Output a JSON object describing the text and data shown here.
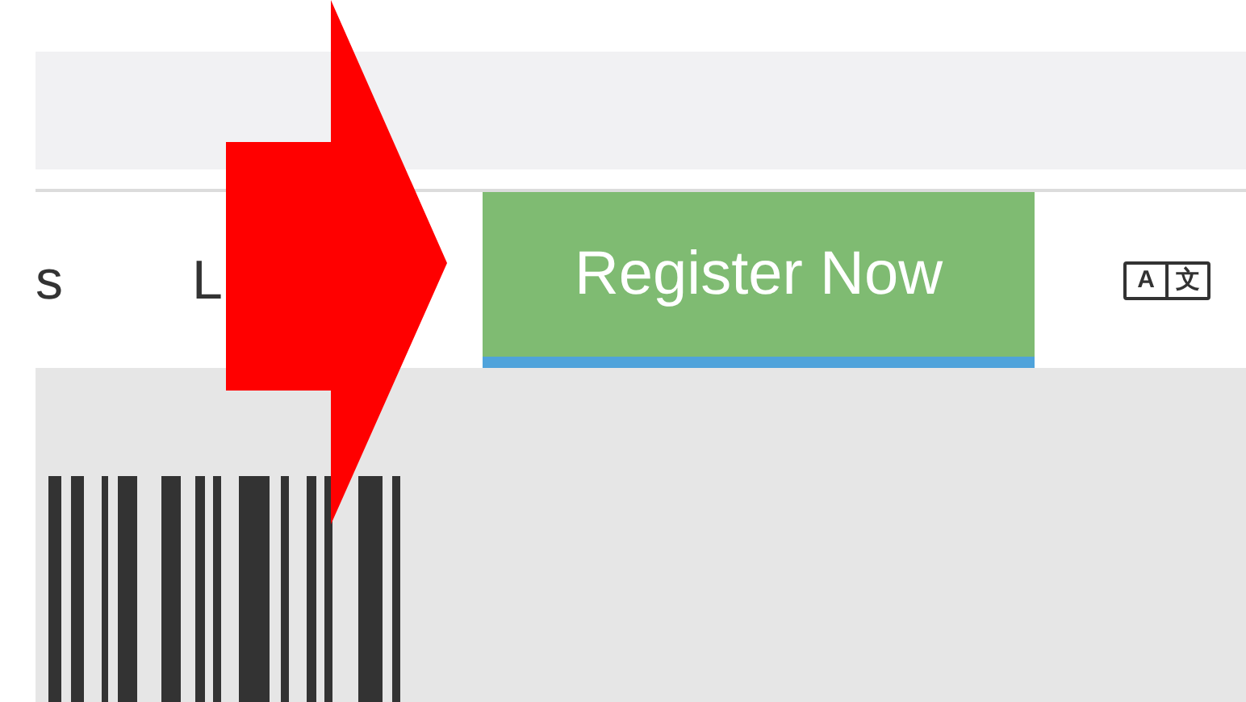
{
  "nav": {
    "items": [
      {
        "label": "s"
      },
      {
        "label": "L"
      }
    ],
    "register_button": {
      "label": "Register Now",
      "selected": true
    },
    "language_button": {
      "glyphs": [
        "A",
        "文"
      ]
    }
  }
}
